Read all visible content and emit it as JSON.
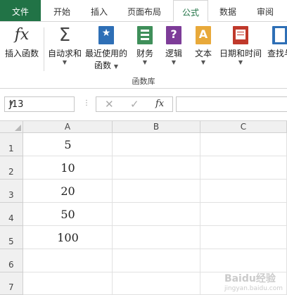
{
  "tabs": [
    {
      "label": "文件"
    },
    {
      "label": "开始"
    },
    {
      "label": "插入"
    },
    {
      "label": "页面布局"
    },
    {
      "label": "公式"
    },
    {
      "label": "数据"
    },
    {
      "label": "审阅"
    }
  ],
  "ribbon": {
    "insert_function": {
      "icon_text": "fx",
      "label": "插入函数"
    },
    "autosum": {
      "icon_text": "Σ",
      "label": "自动求和"
    },
    "recent": {
      "label_line1": "最近使用的",
      "label_line2": "函数"
    },
    "financial": {
      "label": "财务"
    },
    "logical": {
      "label": "逻辑",
      "icon_text": "?"
    },
    "text": {
      "label": "文本",
      "icon_text": "A"
    },
    "datetime": {
      "label": "日期和时间"
    },
    "lookup": {
      "label": "查找与"
    },
    "group_label": "函数库"
  },
  "formula_bar": {
    "name_box": "J13",
    "fx_label": "fx",
    "formula": ""
  },
  "grid": {
    "columns": [
      "A",
      "B",
      "C"
    ],
    "rows": [
      {
        "num": "1",
        "A": "5"
      },
      {
        "num": "2",
        "A": "10"
      },
      {
        "num": "3",
        "A": "20"
      },
      {
        "num": "4",
        "A": "50"
      },
      {
        "num": "5",
        "A": "100"
      },
      {
        "num": "6",
        "A": ""
      },
      {
        "num": "7",
        "A": ""
      }
    ]
  },
  "watermark": {
    "main": "Baidu经验",
    "sub": "jingyan.baidu.com"
  },
  "colors": {
    "file_tab": "#217346",
    "active_tab_text": "#217346"
  }
}
